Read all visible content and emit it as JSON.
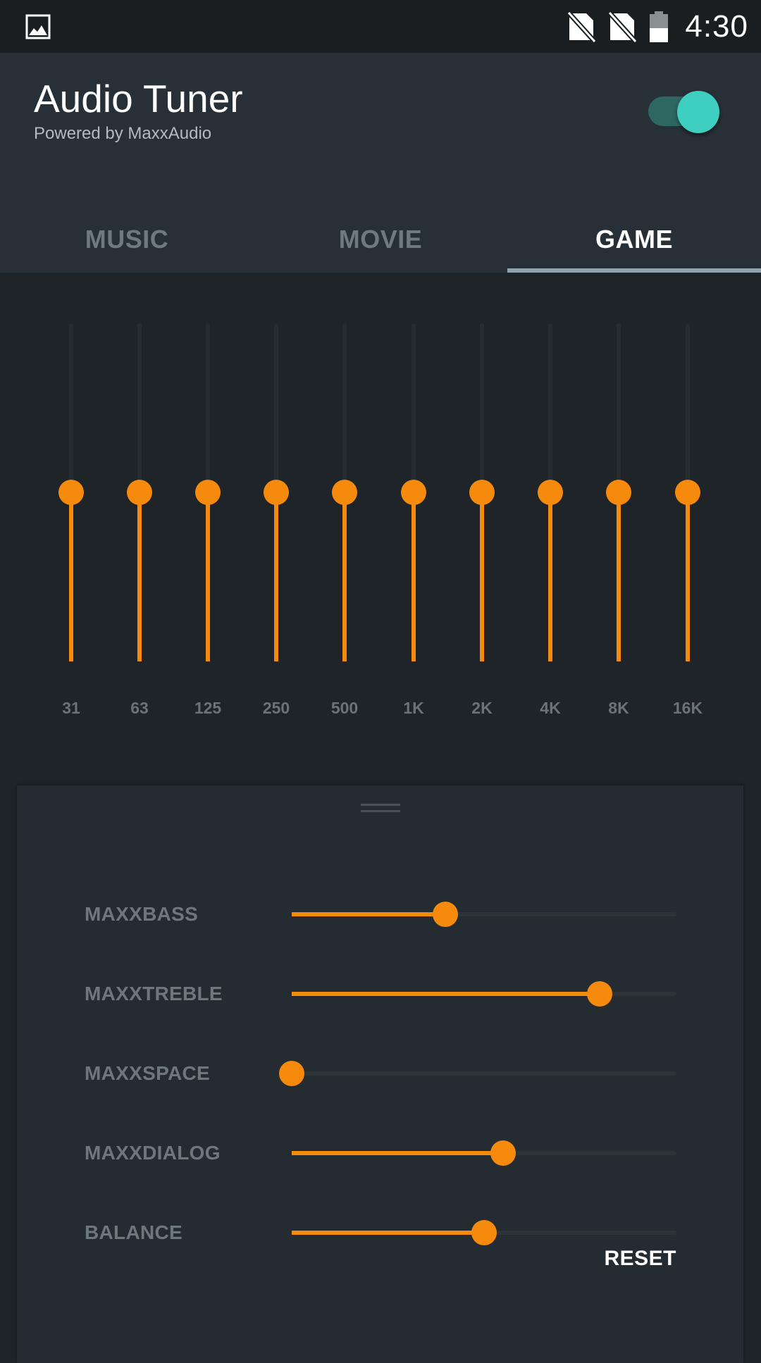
{
  "status_bar": {
    "time": "4:30",
    "icons": [
      "gallery-icon",
      "no-sim-icon",
      "no-sim-icon",
      "battery-icon"
    ]
  },
  "header": {
    "title": "Audio Tuner",
    "subtitle": "Powered by MaxxAudio",
    "toggle_on": true
  },
  "tabs": [
    {
      "label": "MUSIC",
      "active": false
    },
    {
      "label": "MOVIE",
      "active": false
    },
    {
      "label": "GAME",
      "active": true
    }
  ],
  "equalizer": {
    "bands": [
      {
        "label": "31",
        "level": 0.5
      },
      {
        "label": "63",
        "level": 0.5
      },
      {
        "label": "125",
        "level": 0.5
      },
      {
        "label": "250",
        "level": 0.5
      },
      {
        "label": "500",
        "level": 0.5
      },
      {
        "label": "1K",
        "level": 0.5
      },
      {
        "label": "2K",
        "level": 0.5
      },
      {
        "label": "4K",
        "level": 0.5
      },
      {
        "label": "8K",
        "level": 0.5
      },
      {
        "label": "16K",
        "level": 0.5
      }
    ]
  },
  "effects": {
    "sliders": [
      {
        "label": "MAXXBASS",
        "value": 0.4
      },
      {
        "label": "MAXXTREBLE",
        "value": 0.8
      },
      {
        "label": "MAXXSPACE",
        "value": 0.0
      },
      {
        "label": "MAXXDIALOG",
        "value": 0.55
      },
      {
        "label": "BALANCE",
        "value": 0.5
      }
    ],
    "reset_label": "RESET"
  },
  "colors": {
    "accent": "#f68a0d",
    "toggle_knob": "#3ecfc1",
    "toggle_track": "#2e6662",
    "header_bg": "#263036",
    "body_bg": "#1e2427"
  }
}
